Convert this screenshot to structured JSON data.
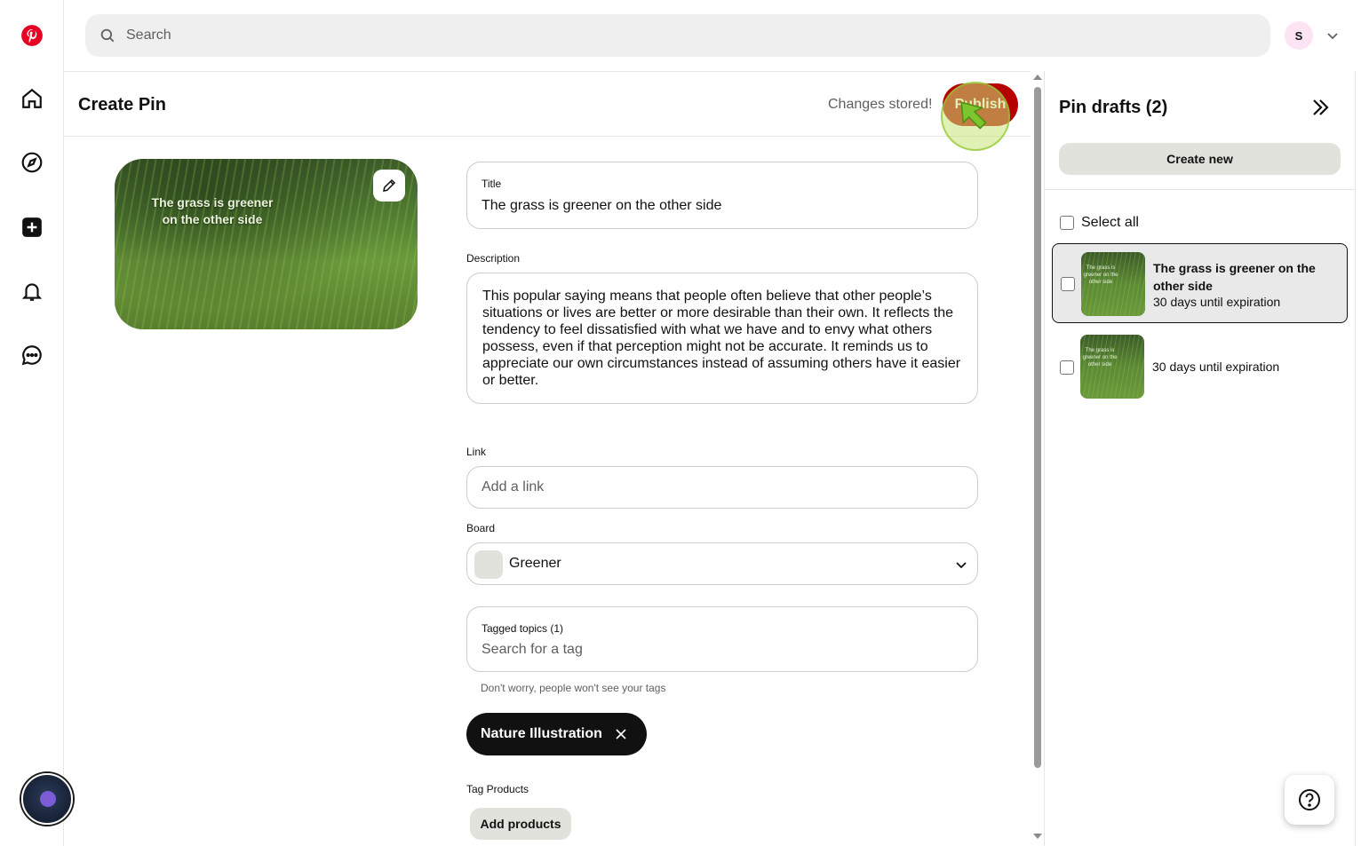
{
  "app": {
    "brand_color": "#e60023",
    "accent_button": "#b60000"
  },
  "nav": {
    "items": [
      {
        "name": "home",
        "icon": "home-icon"
      },
      {
        "name": "explore",
        "icon": "compass-icon"
      },
      {
        "name": "create",
        "icon": "plus-square-icon"
      },
      {
        "name": "notifications",
        "icon": "bell-icon"
      },
      {
        "name": "messages",
        "icon": "chat-icon"
      }
    ]
  },
  "header": {
    "search_placeholder": "Search",
    "avatar_initial": "S"
  },
  "create": {
    "title": "Create Pin",
    "status": "Changes stored!",
    "publish_label": "Publish",
    "preview_text": "The grass is greener on the other side",
    "fields": {
      "title_label": "Title",
      "title_value": "The grass is greener on the other side",
      "description_label": "Description",
      "description_value": "This popular saying means that people often believe that other people’s situations or lives are better or more desirable than their own. It reflects the tendency to feel dissatisfied with what we have and to envy what others possess, even if that perception might not be accurate. It reminds us to appreciate our own circumstances instead of assuming others have it easier or better.",
      "link_label": "Link",
      "link_placeholder": "Add a link",
      "board_label": "Board",
      "board_value": "Greener",
      "tags_label": "Tagged topics (1)",
      "tags_placeholder": "Search for a tag",
      "tags_hint": "Don't worry, people won't see your tags",
      "tag_chip": "Nature Illustration",
      "products_label": "Tag Products",
      "products_button": "Add products"
    }
  },
  "drafts": {
    "title": "Pin drafts (2)",
    "create_new": "Create new",
    "select_all": "Select all",
    "items": [
      {
        "title": "The grass is greener on the other side",
        "expiration": "30 days until expiration",
        "thumb_text": "The grass is greener on the other side"
      },
      {
        "title": "",
        "expiration": "30 days until expiration",
        "thumb_text": "The grass is greener on the other side"
      }
    ]
  }
}
